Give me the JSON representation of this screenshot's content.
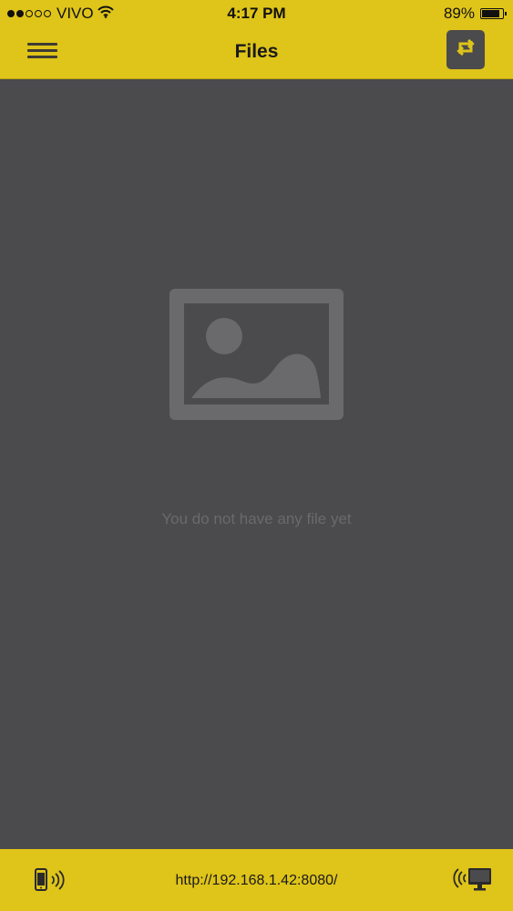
{
  "status_bar": {
    "signal_dots": [
      1,
      1,
      0,
      0,
      0
    ],
    "carrier": "VIVO",
    "time": "4:17 PM",
    "battery_text": "89%",
    "battery_level": 0.89
  },
  "nav": {
    "title": "Files",
    "menu_icon": "hamburger-menu-icon",
    "action_icon": "sync-arrows-icon"
  },
  "empty_state": {
    "icon": "image-placeholder-icon",
    "message": "You do not have any file yet"
  },
  "footer": {
    "server_url": "http://192.168.1.42:8080/",
    "left_icon": "phone-broadcast-icon",
    "right_icon": "monitor-broadcast-icon"
  },
  "colors": {
    "accent": "#dfc419",
    "background": "#4b4a4c",
    "placeholder": "#6a696b"
  }
}
